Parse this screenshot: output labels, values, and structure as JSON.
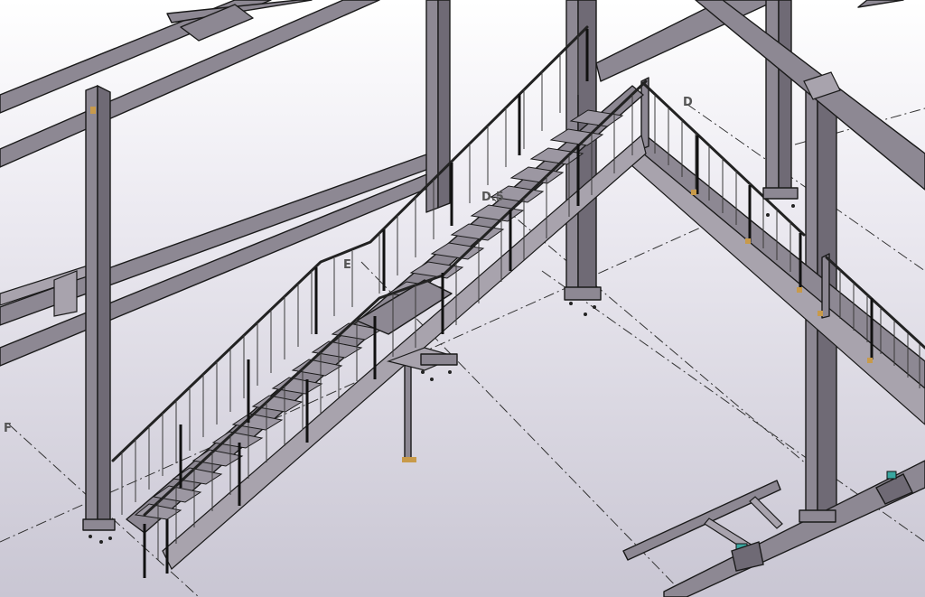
{
  "viewport": {
    "background_top": "#ffffff",
    "background_bottom": "#c9c6d3"
  },
  "grid_labels": {
    "F": "F",
    "E": "E",
    "D": "D",
    "D5": "D.5"
  },
  "colors": {
    "steel": "#8d8893",
    "edge": "#1a1a1a",
    "baseplate": "#c89a4a",
    "accent": "#39a6a0"
  }
}
